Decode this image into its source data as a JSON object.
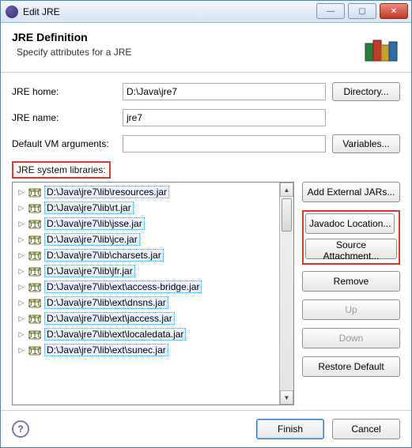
{
  "window": {
    "title": "Edit JRE"
  },
  "header": {
    "title": "JRE Definition",
    "hint": "Specify attributes for a JRE"
  },
  "fields": {
    "home_label": "JRE home:",
    "home_value": "D:\\Java\\jre7",
    "home_btn": "Directory...",
    "name_label": "JRE name:",
    "name_value": "jre7",
    "args_label": "Default VM arguments:",
    "args_value": "",
    "args_btn": "Variables...",
    "libs_label": "JRE system libraries:"
  },
  "libs": [
    "D:\\Java\\jre7\\lib\\resources.jar",
    "D:\\Java\\jre7\\lib\\rt.jar",
    "D:\\Java\\jre7\\lib\\jsse.jar",
    "D:\\Java\\jre7\\lib\\jce.jar",
    "D:\\Java\\jre7\\lib\\charsets.jar",
    "D:\\Java\\jre7\\lib\\jfr.jar",
    "D:\\Java\\jre7\\lib\\ext\\access-bridge.jar",
    "D:\\Java\\jre7\\lib\\ext\\dnsns.jar",
    "D:\\Java\\jre7\\lib\\ext\\jaccess.jar",
    "D:\\Java\\jre7\\lib\\ext\\localedata.jar",
    "D:\\Java\\jre7\\lib\\ext\\sunec.jar"
  ],
  "side": {
    "add": "Add External JARs...",
    "javadoc": "Javadoc Location...",
    "source": "Source Attachment...",
    "remove": "Remove",
    "up": "Up",
    "down": "Down",
    "restore": "Restore Default"
  },
  "footer": {
    "finish": "Finish",
    "cancel": "Cancel"
  }
}
